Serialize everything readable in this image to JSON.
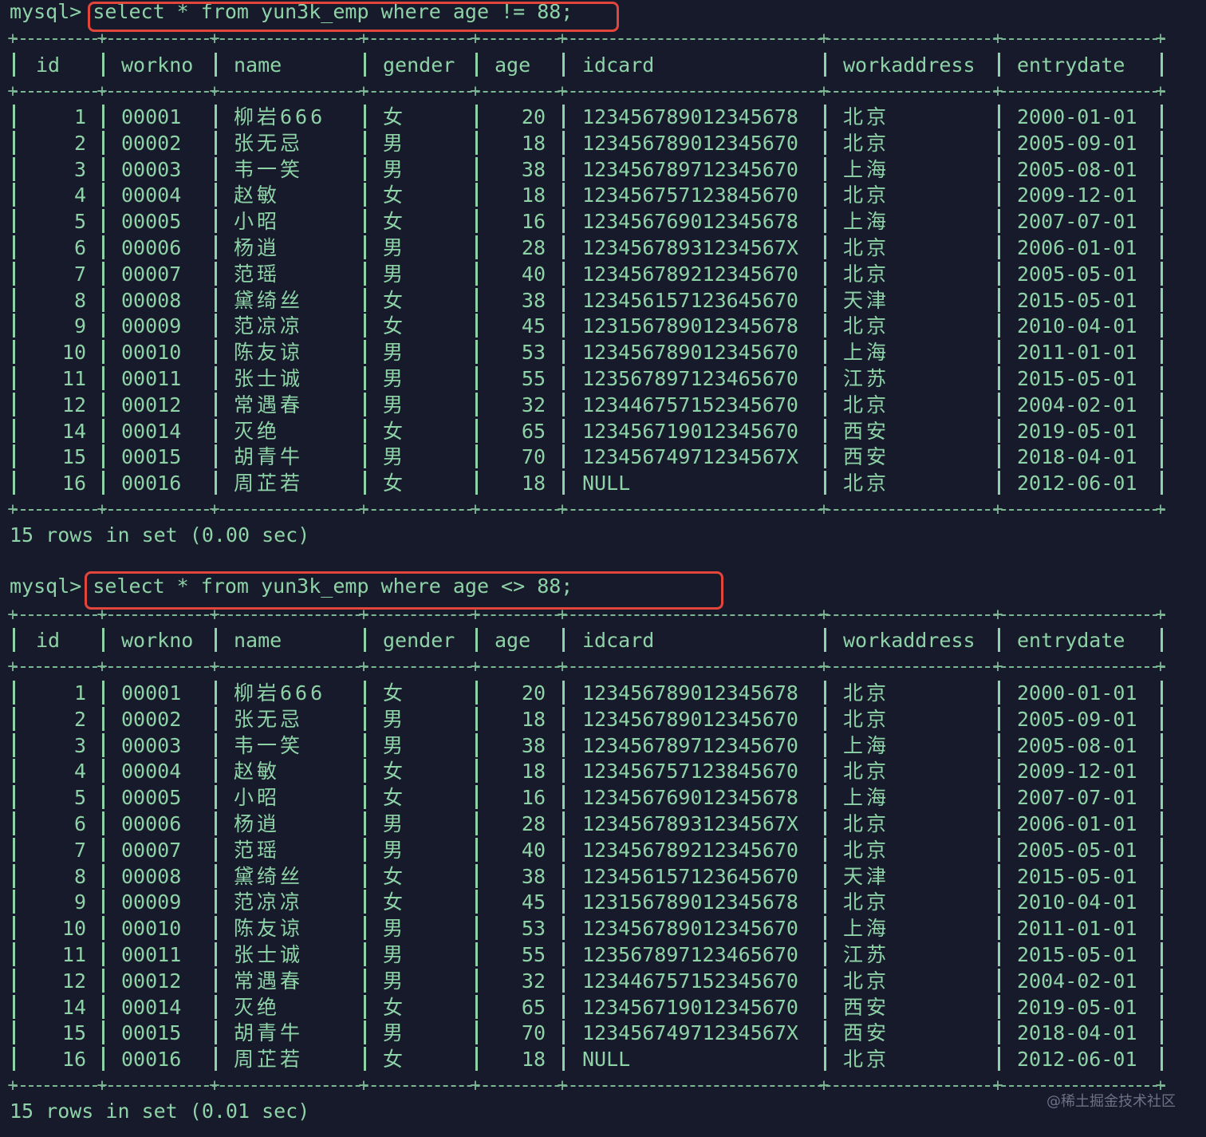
{
  "queries": [
    {
      "prompt": "mysql>",
      "command": "select * from yun3k_emp where age != 88;",
      "footer": "15 rows in set (0.00 sec)"
    },
    {
      "prompt": "mysql>",
      "command": "select * from yun3k_emp where age <> 88;",
      "footer": "15 rows in set (0.01 sec)"
    }
  ],
  "columns": [
    "id",
    "workno",
    "name",
    "gender",
    "age",
    "idcard",
    "workaddress",
    "entrydate"
  ],
  "rows": [
    [
      "1",
      "00001",
      "柳岩666",
      "女",
      "20",
      "123456789012345678",
      "北京",
      "2000-01-01"
    ],
    [
      "2",
      "00002",
      "张无忌",
      "男",
      "18",
      "123456789012345670",
      "北京",
      "2005-09-01"
    ],
    [
      "3",
      "00003",
      "韦一笑",
      "男",
      "38",
      "123456789712345670",
      "上海",
      "2005-08-01"
    ],
    [
      "4",
      "00004",
      "赵敏",
      "女",
      "18",
      "123456757123845670",
      "北京",
      "2009-12-01"
    ],
    [
      "5",
      "00005",
      "小昭",
      "女",
      "16",
      "123456769012345678",
      "上海",
      "2007-07-01"
    ],
    [
      "6",
      "00006",
      "杨逍",
      "男",
      "28",
      "12345678931234567X",
      "北京",
      "2006-01-01"
    ],
    [
      "7",
      "00007",
      "范瑶",
      "男",
      "40",
      "123456789212345670",
      "北京",
      "2005-05-01"
    ],
    [
      "8",
      "00008",
      "黛绮丝",
      "女",
      "38",
      "123456157123645670",
      "天津",
      "2015-05-01"
    ],
    [
      "9",
      "00009",
      "范凉凉",
      "女",
      "45",
      "123156789012345678",
      "北京",
      "2010-04-01"
    ],
    [
      "10",
      "00010",
      "陈友谅",
      "男",
      "53",
      "123456789012345670",
      "上海",
      "2011-01-01"
    ],
    [
      "11",
      "00011",
      "张士诚",
      "男",
      "55",
      "123567897123465670",
      "江苏",
      "2015-05-01"
    ],
    [
      "12",
      "00012",
      "常遇春",
      "男",
      "32",
      "123446757152345670",
      "北京",
      "2004-02-01"
    ],
    [
      "14",
      "00014",
      "灭绝",
      "女",
      "65",
      "123456719012345670",
      "西安",
      "2019-05-01"
    ],
    [
      "15",
      "00015",
      "胡青牛",
      "男",
      "70",
      "12345674971234567X",
      "西安",
      "2018-04-01"
    ],
    [
      "16",
      "00016",
      "周芷若",
      "女",
      "18",
      "NULL",
      "北京",
      "2012-06-01"
    ]
  ],
  "watermark": "@稀土掘金技术社区"
}
